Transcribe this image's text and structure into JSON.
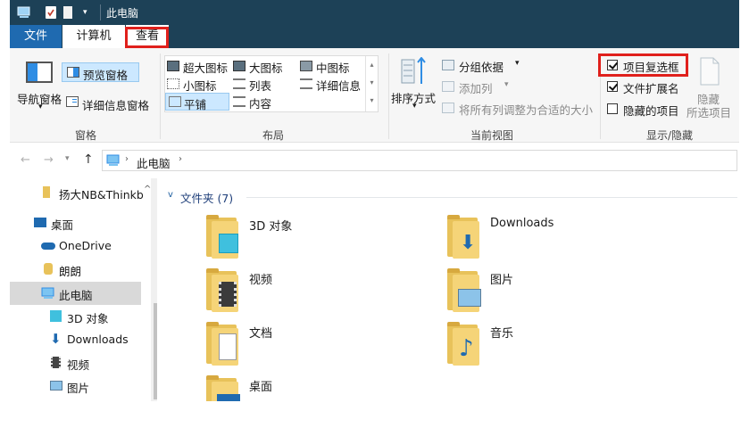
{
  "window": {
    "title": "此电脑"
  },
  "tabs": {
    "file": "文件",
    "computer": "计算机",
    "view": "查看"
  },
  "ribbon": {
    "panes": {
      "group_label": "窗格",
      "nav_pane": "导航窗格",
      "preview_pane": "预览窗格",
      "details_pane": "详细信息窗格"
    },
    "layout": {
      "group_label": "布局",
      "items": [
        "超大图标",
        "大图标",
        "中图标",
        "小图标",
        "列表",
        "详细信息",
        "平铺",
        "内容"
      ]
    },
    "current_view": {
      "group_label": "当前视图",
      "sort_by": "排序方式",
      "group_by": "分组依据",
      "add_columns": "添加列",
      "size_all_columns": "将所有列调整为合适的大小"
    },
    "show_hide": {
      "group_label": "显示/隐藏",
      "item_checkboxes": "项目复选框",
      "file_extensions": "文件扩展名",
      "hidden_items": "隐藏的项目",
      "hide": "隐藏",
      "hide_selected": "所选项目"
    }
  },
  "address": {
    "path": "此电脑"
  },
  "nav": {
    "items": [
      "扬大NB&Thinkb",
      "桌面",
      "OneDrive",
      "朗朗",
      "此电脑",
      "3D 对象",
      "Downloads",
      "视频",
      "图片"
    ]
  },
  "content": {
    "section": "文件夹 (7)",
    "folders": [
      "3D 对象",
      "Downloads",
      "视频",
      "图片",
      "文档",
      "音乐",
      "桌面"
    ]
  },
  "colors": {
    "titlebar": "#1d4157",
    "highlight": "#cce8ff",
    "annotation": "#e0201c",
    "folder": "#f5d478"
  }
}
